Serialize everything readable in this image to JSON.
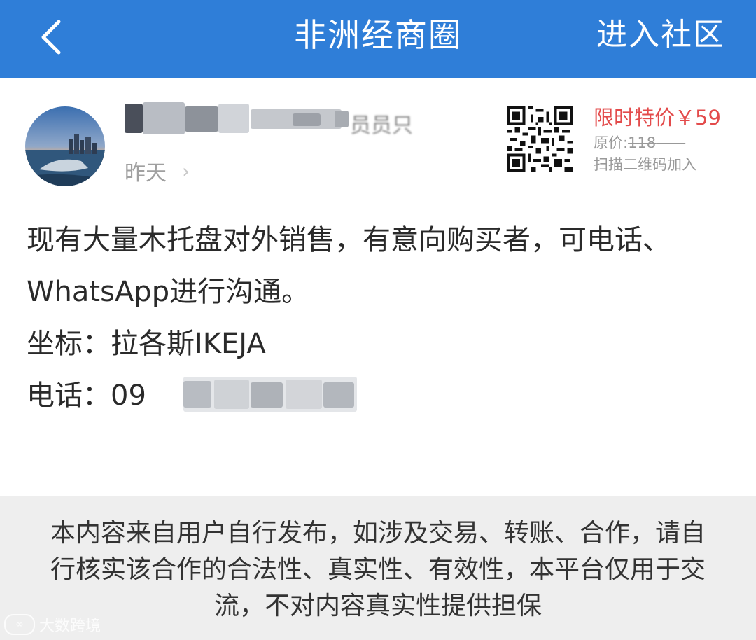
{
  "header": {
    "title": "非洲经商圈",
    "action_label": "进入社区",
    "back_icon": "chevron-left-icon"
  },
  "post": {
    "author_suffix": "员员只",
    "time": "昨天",
    "body_line": "现有大量木托盘对外销售，有意向购买者，可电话、WhatsApp进行沟通。",
    "location_line": "坐标：拉各斯IKEJA",
    "phone_label": "电话：",
    "phone_visible": "09"
  },
  "promo": {
    "price_label": "限时特价￥59",
    "orig_prefix": "原价:",
    "orig_value": "118",
    "scan_label": "扫描二维码加入"
  },
  "disclaimer": {
    "text": "本内容来自用户自行发布，如涉及交易、转账、合作，请自行核实该合作的合法性、真实性、有效性，本平台仅用于交流，不对内容真实性提供担保"
  },
  "watermark": {
    "text": "大数跨境"
  },
  "colors": {
    "header_bg": "#2f7ed8",
    "promo_red": "#e34b4b",
    "disclaimer_bg": "#eeeeee"
  }
}
